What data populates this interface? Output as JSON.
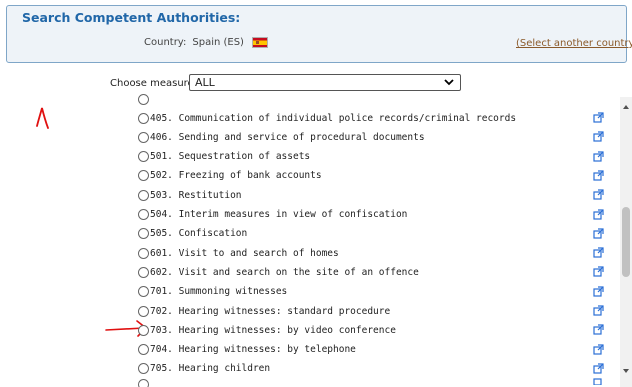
{
  "panel": {
    "title": "Search Competent Authorities:",
    "country_label": "Country:",
    "country_value": "Spain (ES)",
    "select_another": "(Select another country)"
  },
  "measure": {
    "label": "Choose measure:",
    "selected": "ALL"
  },
  "items": [
    {
      "label": "405. Communication of individual police records/criminal records"
    },
    {
      "label": "406. Sending and service of procedural documents"
    },
    {
      "label": "501. Sequestration of assets"
    },
    {
      "label": "502. Freezing of bank accounts"
    },
    {
      "label": "503. Restitution"
    },
    {
      "label": "504. Interim measures in view of confiscation"
    },
    {
      "label": "505. Confiscation"
    },
    {
      "label": "601. Visit to and search of homes"
    },
    {
      "label": "602. Visit and search on the site of an offence"
    },
    {
      "label": "701. Summoning witnesses"
    },
    {
      "label": "702. Hearing witnesses: standard procedure"
    },
    {
      "label": "703. Hearing witnesses: by video conference"
    },
    {
      "label": "704. Hearing witnesses: by telephone"
    },
    {
      "label": "705. Hearing children"
    }
  ],
  "colors": {
    "accent": "#2167a8",
    "link": "#8b5a2b",
    "annotation": "#e01010",
    "external_link": "#2a6fd6"
  }
}
